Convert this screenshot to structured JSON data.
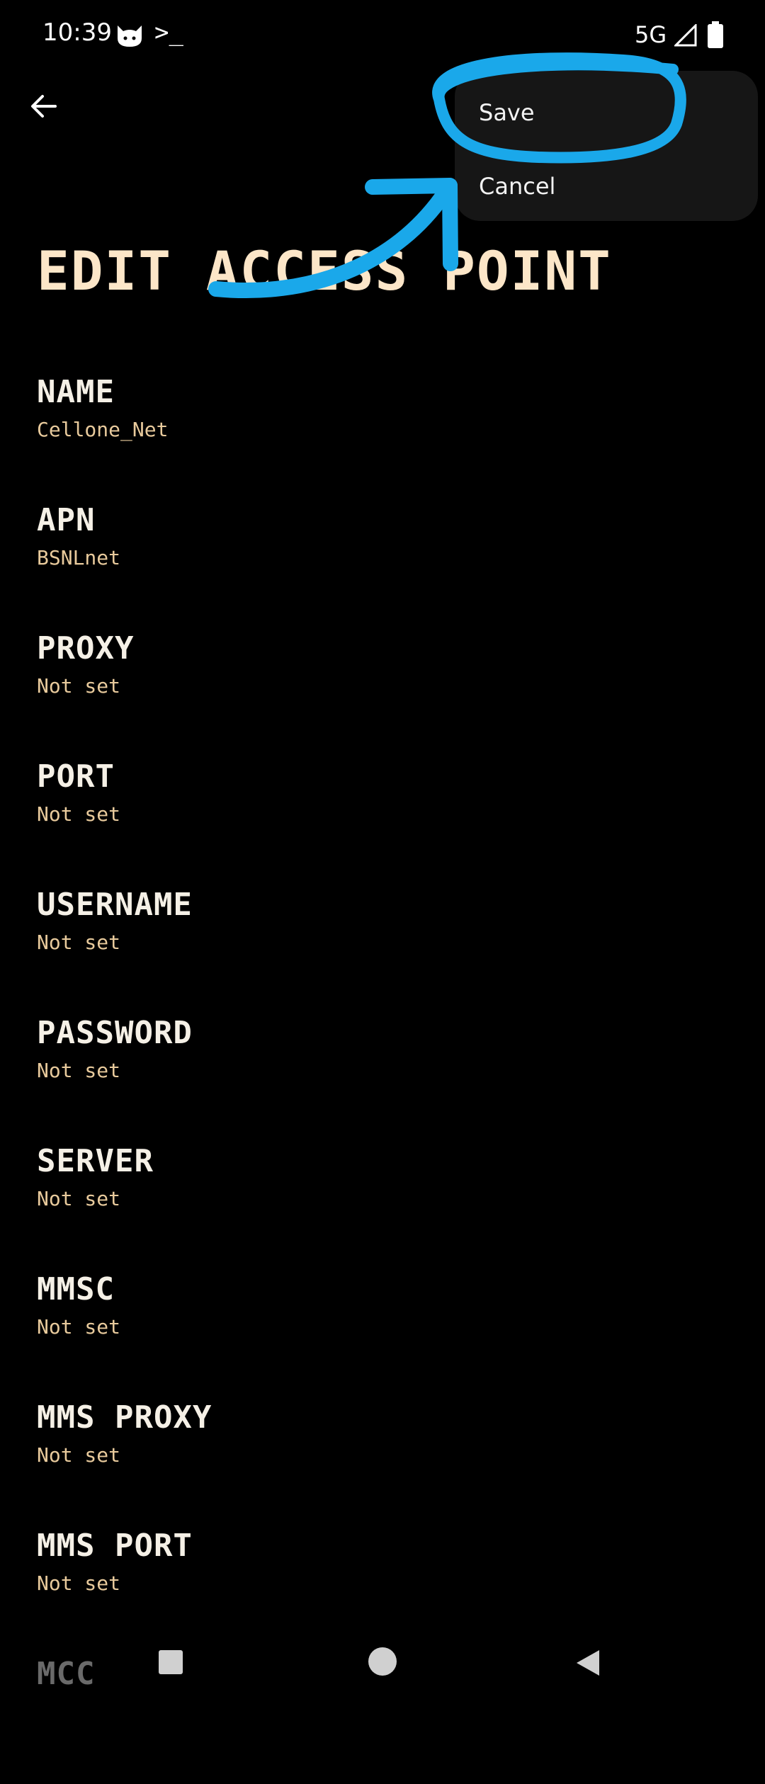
{
  "status_bar": {
    "time": "10:39",
    "terminal_glyph": ">_",
    "network": "5G",
    "icons": [
      "cat-icon",
      "terminal-icon",
      "signal-icon",
      "battery-icon"
    ]
  },
  "toolbar": {
    "back_icon": "arrow-back-icon"
  },
  "menu": {
    "save_label": "Save",
    "cancel_label": "Cancel"
  },
  "page": {
    "title": "EDIT ACCESS POINT"
  },
  "settings": [
    {
      "label": "NAME",
      "value": "Cellone_Net"
    },
    {
      "label": "APN",
      "value": "BSNLnet"
    },
    {
      "label": "PROXY",
      "value": "Not set"
    },
    {
      "label": "PORT",
      "value": "Not set"
    },
    {
      "label": "USERNAME",
      "value": "Not set"
    },
    {
      "label": "PASSWORD",
      "value": "Not set"
    },
    {
      "label": "SERVER",
      "value": "Not set"
    },
    {
      "label": "MMSC",
      "value": "Not set"
    },
    {
      "label": "MMS PROXY",
      "value": "Not set"
    },
    {
      "label": "MMS PORT",
      "value": "Not set"
    },
    {
      "label": "MCC",
      "value": ""
    }
  ],
  "nav_bar": {
    "icons": [
      "recents-icon",
      "home-icon",
      "back-triangle-icon"
    ]
  },
  "colors": {
    "background": "#000000",
    "title": "#fce6c8",
    "value": "#e8ca9c",
    "menu_bg": "#161616",
    "annotation": "#1aa8ea"
  }
}
